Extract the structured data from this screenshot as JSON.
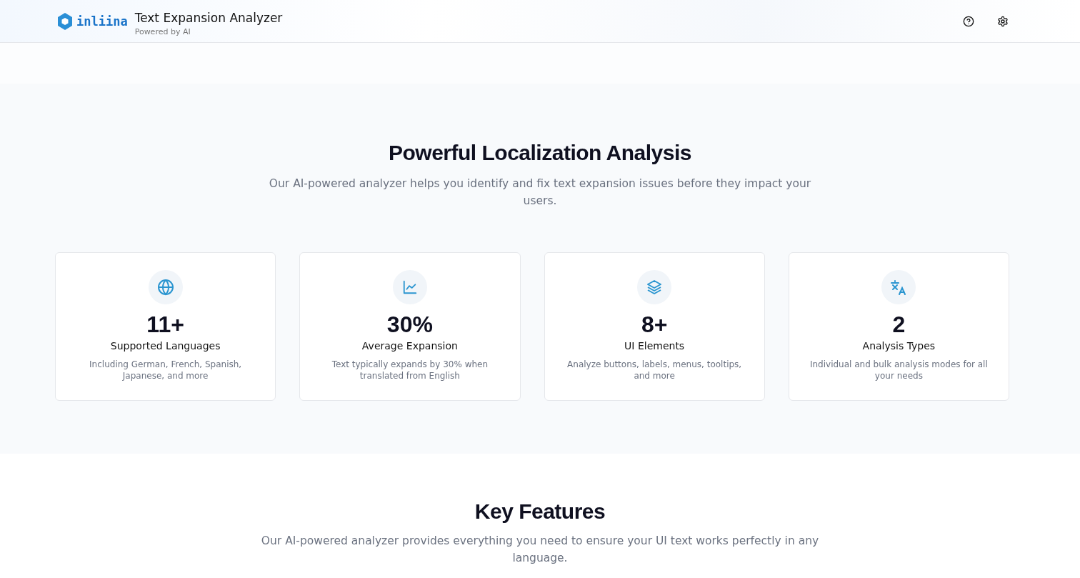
{
  "header": {
    "logo": "inliina",
    "title": "Text Expansion Analyzer",
    "subtitle": "Powered by AI"
  },
  "stats_section": {
    "title": "Powerful Localization Analysis",
    "description": "Our AI-powered analyzer helps you identify and fix text expansion issues before they impact your users.",
    "cards": [
      {
        "kind": "globe",
        "value": "11+",
        "label": "Supported Languages",
        "description": "Including German, French, Spanish, Japanese, and more"
      },
      {
        "kind": "chart",
        "value": "30%",
        "label": "Average Expansion",
        "description": "Text typically expands by 30% when translated from English"
      },
      {
        "kind": "layers",
        "value": "8+",
        "label": "UI Elements",
        "description": "Analyze buttons, labels, menus, tooltips, and more"
      },
      {
        "kind": "translate",
        "value": "2",
        "label": "Analysis Types",
        "description": "Individual and bulk analysis modes for all your needs"
      }
    ]
  },
  "features_section": {
    "title": "Key Features",
    "description": "Our AI-powered analyzer provides everything you need to ensure your UI text works perfectly in any language."
  }
}
